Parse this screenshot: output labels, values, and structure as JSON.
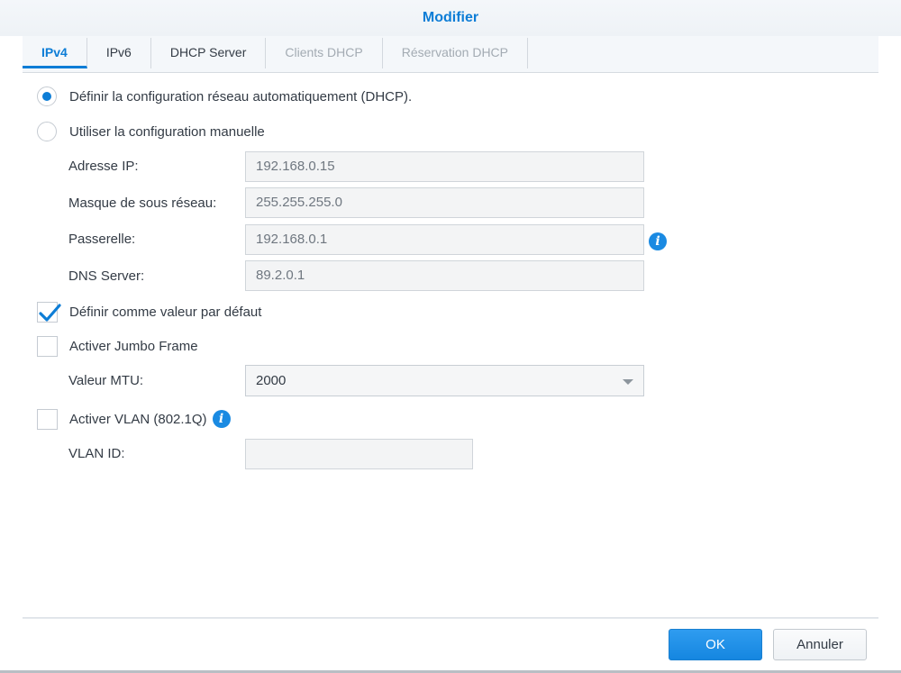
{
  "dialog": {
    "title": "Modifier"
  },
  "tabs": [
    {
      "label": "IPv4",
      "state": "active"
    },
    {
      "label": "IPv6",
      "state": "normal"
    },
    {
      "label": "DHCP Server",
      "state": "normal"
    },
    {
      "label": "Clients DHCP",
      "state": "disabled"
    },
    {
      "label": "Réservation DHCP",
      "state": "disabled"
    }
  ],
  "options": {
    "auto_dhcp": {
      "label": "Définir la configuration réseau automatiquement (DHCP).",
      "checked": true
    },
    "manual": {
      "label": "Utiliser la configuration manuelle",
      "checked": false
    }
  },
  "fields": {
    "ip": {
      "label": "Adresse IP:",
      "value": "192.168.0.15"
    },
    "mask": {
      "label": "Masque de sous réseau:",
      "value": "255.255.255.0"
    },
    "gateway": {
      "label": "Passerelle:",
      "value": "192.168.0.1"
    },
    "dns": {
      "label": "DNS Server:",
      "value": "89.2.0.1"
    }
  },
  "checkboxes": {
    "default": {
      "label": "Définir comme valeur par défaut",
      "checked": true
    },
    "jumbo": {
      "label": "Activer Jumbo Frame",
      "checked": false
    },
    "vlan": {
      "label": "Activer VLAN (802.1Q)",
      "checked": false
    }
  },
  "mtu": {
    "label": "Valeur MTU:",
    "value": "2000"
  },
  "vlan_id": {
    "label": "VLAN ID:",
    "value": ""
  },
  "buttons": {
    "ok": "OK",
    "cancel": "Annuler"
  },
  "icons": {
    "info": "i"
  },
  "colors": {
    "accent": "#0d7dd6",
    "primary_button": "#1a8ae2"
  }
}
